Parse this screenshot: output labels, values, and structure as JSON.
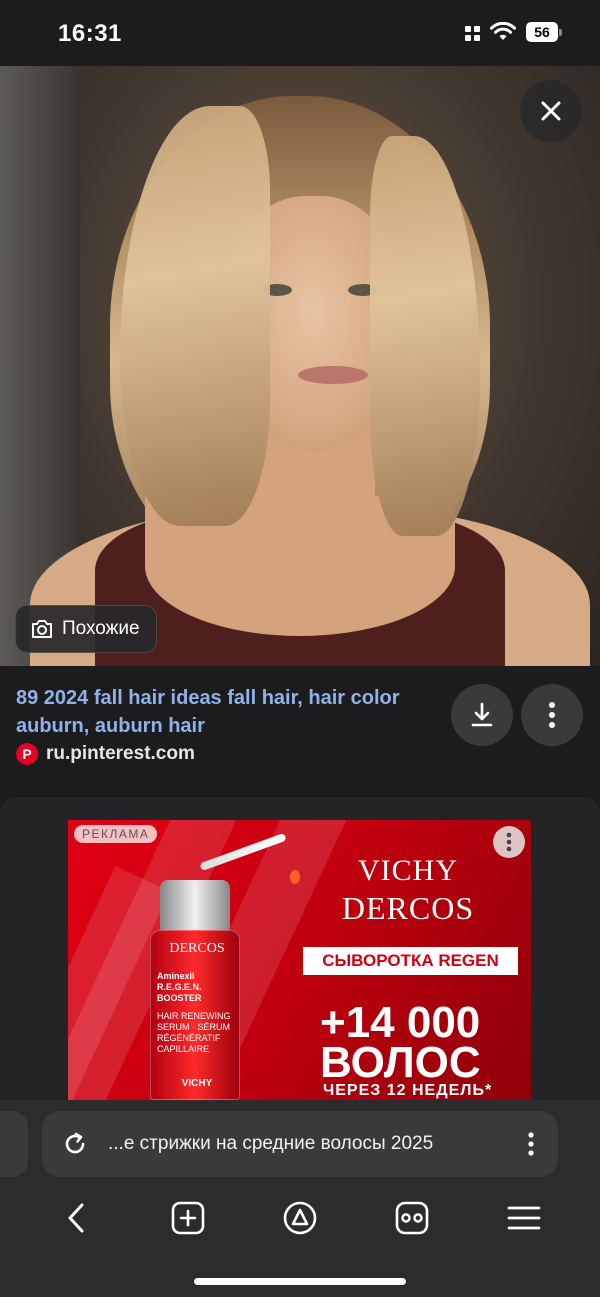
{
  "status_bar": {
    "time": "16:31",
    "battery": "56"
  },
  "viewer": {
    "close_label": "close",
    "similar_button": "Похожие"
  },
  "result": {
    "title": "89 2024 fall hair ideas fall hair, hair color auburn, auburn hair",
    "source": "ru.pinterest.com",
    "source_icon_letter": "P"
  },
  "ad": {
    "label": "РЕКЛАМА",
    "brand": "VICHY",
    "product": "DERCOS",
    "pill": "СЫВОРОТКА REGEN",
    "headline_1": "+14 000",
    "headline_2": "ВОЛОС",
    "subline": "ЧЕРЕЗ 12 НЕДЕЛЬ*",
    "bottle_brand": "DERCOS",
    "bottle_name": "Aminexil R.E.G.E.N. BOOSTER",
    "bottle_desc": "HAIR RENEWING SERUM · SÉRUM RÉGÉNÉRATIF CAPILLAIRE",
    "bottle_vichy": "VICHY"
  },
  "search_bar": {
    "query": "...е стрижки на средние волосы 2025"
  },
  "colors": {
    "background": "#1c1c1e",
    "link": "#8fb2e8",
    "ad_red": "#d30012",
    "pinterest": "#e60023"
  },
  "nav": {
    "items": [
      "back-icon",
      "new-tab-icon",
      "alice-icon",
      "tabs-icon",
      "menu-icon"
    ]
  }
}
